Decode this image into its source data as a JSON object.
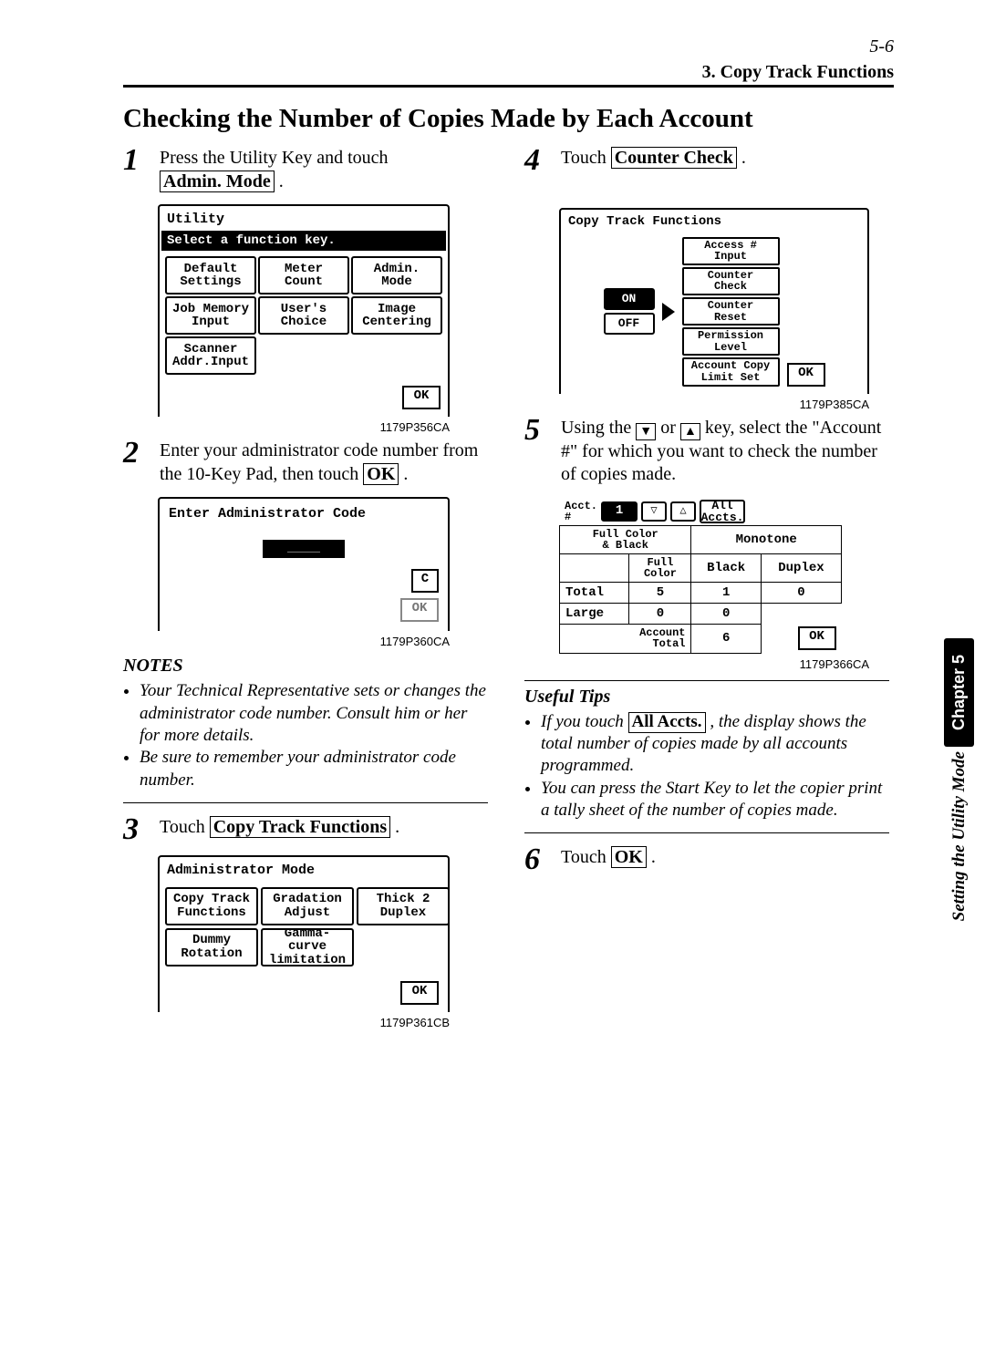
{
  "page_number": "5-6",
  "header": "3. Copy Track Functions",
  "title": "Checking the Number of Copies Made by Each Account",
  "sidebar_chapter": "Chapter 5",
  "sidebar_caption": "Setting the Utility Mode",
  "steps": {
    "s1": {
      "n": "1",
      "text_a": "Press the Utility Key and touch ",
      "btn": "Admin. Mode",
      "text_b": " ."
    },
    "s2": {
      "n": "2",
      "text_a": "Enter your administrator code number from the 10-Key Pad, then touch ",
      "btn": "OK",
      "text_b": " ."
    },
    "s3": {
      "n": "3",
      "text_a": "Touch ",
      "btn": "Copy Track Functions",
      "text_b": " ."
    },
    "s4": {
      "n": "4",
      "text_a": "Touch ",
      "btn": "Counter Check",
      "text_b": " ."
    },
    "s5": {
      "n": "5",
      "text_a": "Using the ",
      "text_b": " or ",
      "text_c": " key, select the \"Account #\" for which you want to check the number of copies made."
    },
    "s6": {
      "n": "6",
      "text_a": "Touch ",
      "btn": "OK",
      "text_b": " ."
    }
  },
  "notes_title": "NOTES",
  "notes": [
    "Your Technical Representative sets or changes the administrator code number. Consult him or her for more details.",
    "Be sure to remember your administrator code number."
  ],
  "tips_title": "Useful Tips",
  "tips": {
    "t1_a": "If you touch ",
    "t1_btn": "All Accts.",
    "t1_b": " , the display shows the total number of copies made by all accounts programmed.",
    "t2": "You can press the Start Key to let the copier print a tally sheet of the number of copies made."
  },
  "panel1": {
    "title": "Utility",
    "prompt": "Select a function key.",
    "buttons": [
      "Default\nSettings",
      "Meter\nCount",
      "Admin.\nMode",
      "Job Memory\nInput",
      "User's\nChoice",
      "Image\nCentering",
      "Scanner\nAddr.Input"
    ],
    "ok": "OK",
    "cap": "1179P356CA"
  },
  "panel2": {
    "title": "Enter Administrator Code",
    "clear": "C",
    "ok": "OK",
    "cap": "1179P360CA"
  },
  "panel3": {
    "title": "Administrator Mode",
    "buttons": [
      "Copy Track\nFunctions",
      "Gradation\nAdjust",
      "Thick 2\nDuplex",
      "Dummy\nRotation",
      "Gamma-\ncurve\nlimitation"
    ],
    "ok": "OK",
    "cap": "1179P361CB"
  },
  "panel4": {
    "title": "Copy Track Functions",
    "on": "ON",
    "off": "OFF",
    "opts": [
      "Access #\nInput",
      "Counter\nCheck",
      "Counter\nReset",
      "Permission\nLevel",
      "Account Copy\nLimit Set"
    ],
    "ok": "OK",
    "cap": "1179P385CA"
  },
  "panel5": {
    "acct_label": "Acct.\n#",
    "acct_val": "1",
    "all": "All\nAccts.",
    "tab1": "Full Color\n& Black",
    "tab2": "Monotone",
    "col1": "Full\nColor",
    "col2": "Black",
    "col3": "Duplex",
    "row1": "Total",
    "r1c1": "5",
    "r1c2": "1",
    "r1c3": "0",
    "row2": "Large",
    "r2c1": "0",
    "r2c2": "0",
    "foot": "Account\nTotal",
    "foot_val": "6",
    "ok": "OK",
    "cap": "1179P366CA"
  }
}
